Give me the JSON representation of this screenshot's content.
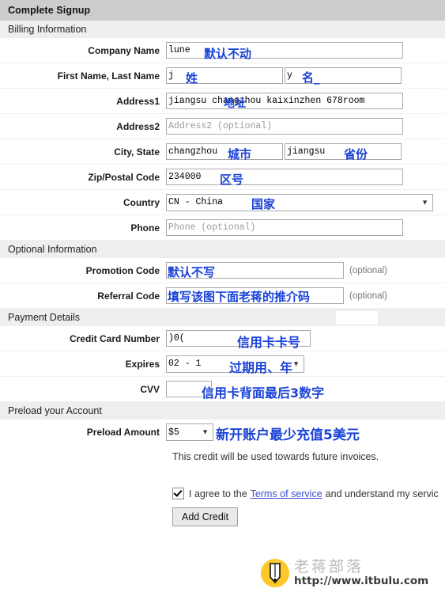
{
  "header": {
    "title": "Complete Signup"
  },
  "sections": {
    "billing": "Billing Information",
    "optional": "Optional Information",
    "payment": "Payment Details",
    "preload": "Preload your Account"
  },
  "labels": {
    "company_name": "Company Name",
    "names": "First Name, Last Name",
    "address1": "Address1",
    "address2": "Address2",
    "city_state": "City, State",
    "zip": "Zip/Postal Code",
    "country": "Country",
    "phone": "Phone",
    "promotion_code": "Promotion Code",
    "referral_code": "Referral Code",
    "credit_card_number": "Credit Card Number",
    "expires": "Expires",
    "cvv": "CVV",
    "preload_amount": "Preload Amount"
  },
  "fields": {
    "company_name": {
      "value": "lune"
    },
    "first_name": {
      "value": "j"
    },
    "last_name": {
      "value": "y"
    },
    "address1": {
      "value": "jiangsu changzhou kaixinzhen 678room"
    },
    "address2": {
      "value": "",
      "placeholder": "Address2 (optional)"
    },
    "city": {
      "value": "changzhou"
    },
    "state": {
      "value": "jiangsu"
    },
    "zip": {
      "value": "234000"
    },
    "country": {
      "value": "CN - China"
    },
    "phone": {
      "value": "",
      "placeholder": "Phone (optional)"
    },
    "promotion_code": {
      "value": "",
      "optional_note": "(optional)"
    },
    "referral_code": {
      "value": "",
      "optional_note": "(optional)"
    },
    "credit_card_number": {
      "value": "              )0("
    },
    "expires": {
      "value": "02 - 1"
    },
    "cvv": {
      "value": ""
    },
    "preload_amount": {
      "value": "$5"
    }
  },
  "annotations": {
    "company_name": "默认不动",
    "first_name": "姓",
    "last_name": "名_",
    "address1": "地址",
    "city": "城市",
    "state": "省份",
    "zip": "区号",
    "country": "国家",
    "promotion_code": "默认不写",
    "referral_code": "填写该图下面老蒋的推介码",
    "credit_card_number": "信用卡卡号",
    "expires": "过期用、年",
    "cvv": "信用卡背面最后3数字",
    "preload_amount": "新开账户最少充值5美元"
  },
  "preload": {
    "credit_note": "This credit will be used towards future invoices.",
    "terms_pre": "I agree to the",
    "terms_link": "Terms of service",
    "terms_post": "and understand my servic",
    "add_credit_button": "Add Credit"
  },
  "watermark": {
    "brand": "老蒋部落",
    "url": "http://www.itbulu.com"
  },
  "colors": {
    "annotation_blue": "#1a43d8",
    "header_bar": "#cccccc",
    "section_bar": "#eeeeee",
    "link_blue": "#3b50c8"
  }
}
